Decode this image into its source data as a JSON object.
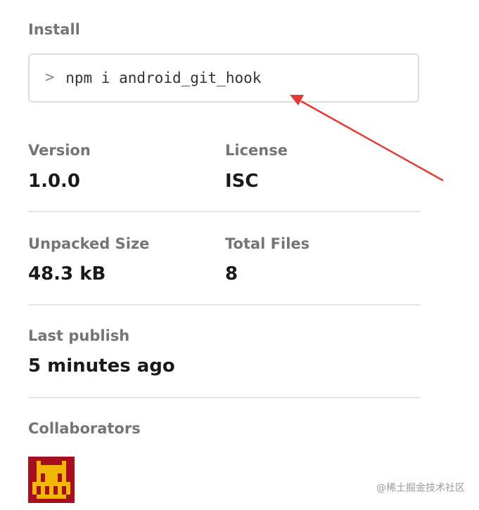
{
  "install": {
    "label": "Install",
    "prompt_icon": "chevron-right-icon",
    "command": "npm i android_git_hook"
  },
  "stats": {
    "version": {
      "label": "Version",
      "value": "1.0.0"
    },
    "license": {
      "label": "License",
      "value": "ISC"
    },
    "unpacked_size": {
      "label": "Unpacked Size",
      "value": "48.3 kB"
    },
    "total_files": {
      "label": "Total Files",
      "value": "8"
    },
    "last_publish": {
      "label": "Last publish",
      "value": "5 minutes ago"
    }
  },
  "collaborators": {
    "label": "Collaborators",
    "avatar_icon": "pixel-avatar-icon"
  },
  "annotation": {
    "arrow_color": "#e53935"
  },
  "watermark": "@稀土掘金技术社区",
  "colors": {
    "label_gray": "#757575",
    "value_dark": "#1a1a1a",
    "border": "#dcdcdc",
    "avatar_red": "#a50f1e",
    "avatar_yellow": "#f2b705"
  }
}
